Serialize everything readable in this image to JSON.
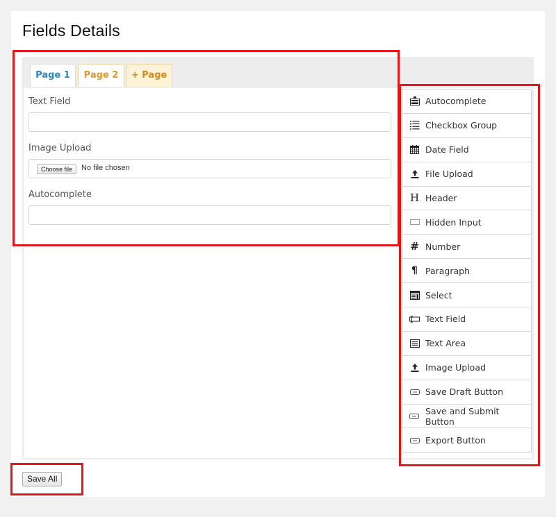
{
  "page": {
    "title": "Fields Details"
  },
  "tabs": [
    {
      "label": "Page 1"
    },
    {
      "label": "Page 2"
    },
    {
      "label": "+ Page"
    }
  ],
  "form": {
    "fields": [
      {
        "label": "Text Field",
        "value": "",
        "placeholder": ""
      },
      {
        "label": "Image Upload",
        "button_label": "Choose file",
        "status": "No file chosen"
      },
      {
        "label": "Autocomplete",
        "value": "",
        "placeholder": ""
      }
    ]
  },
  "palette": {
    "items": [
      {
        "label": "Autocomplete",
        "icon": "autocomplete-icon"
      },
      {
        "label": "Checkbox Group",
        "icon": "checklist-icon"
      },
      {
        "label": "Date Field",
        "icon": "calendar-icon"
      },
      {
        "label": "File Upload",
        "icon": "upload-icon"
      },
      {
        "label": "Header",
        "icon": "header-h-icon"
      },
      {
        "label": "Hidden Input",
        "icon": "hidden-input-icon"
      },
      {
        "label": "Number",
        "icon": "hash-icon"
      },
      {
        "label": "Paragraph",
        "icon": "pilcrow-icon"
      },
      {
        "label": "Select",
        "icon": "select-icon"
      },
      {
        "label": "Text Field",
        "icon": "text-field-icon"
      },
      {
        "label": "Text Area",
        "icon": "text-area-icon"
      },
      {
        "label": "Image Upload",
        "icon": "upload-icon"
      },
      {
        "label": "Save Draft Button",
        "icon": "button-icon"
      },
      {
        "label": "Save and Submit Button",
        "icon": "button-icon"
      },
      {
        "label": "Export Button",
        "icon": "button-icon"
      }
    ]
  },
  "footer": {
    "save_all_label": "Save All"
  },
  "colors": {
    "highlight": "#e0171b",
    "tab_active": "#2a8ac4",
    "tab_inactive": "#e0982f",
    "tab_add_bg": "#fdf4d8"
  }
}
